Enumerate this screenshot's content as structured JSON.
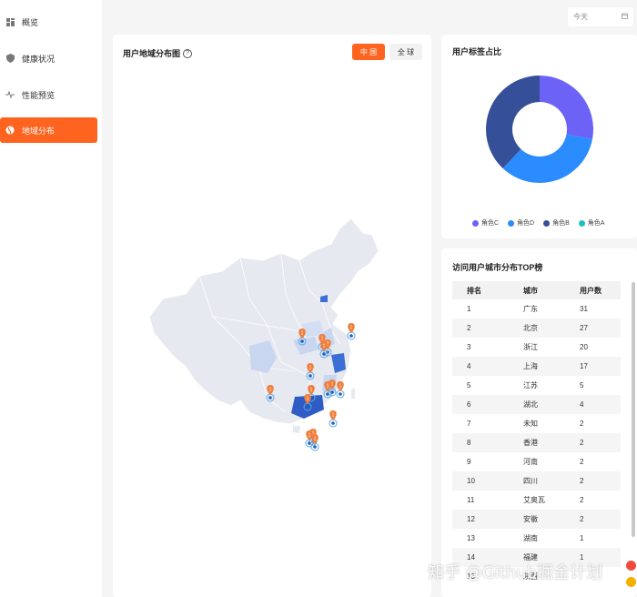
{
  "sidebar": {
    "items": [
      {
        "label": "概览",
        "icon": "dashboard-icon"
      },
      {
        "label": "健康状况",
        "icon": "shield-icon"
      },
      {
        "label": "性能预览",
        "icon": "pulse-icon"
      },
      {
        "label": "地域分布",
        "icon": "globe-icon",
        "active": true
      }
    ]
  },
  "date_picker": {
    "value": "今天",
    "icon": "calendar-icon"
  },
  "map_panel": {
    "title": "用户地域分布图",
    "help_icon": "question-icon",
    "scope_buttons": [
      "中 国",
      "全 球"
    ],
    "active_scope": "中 国",
    "marker_labels": [
      "1",
      "1",
      "1",
      "2",
      "1",
      "1",
      "1",
      "1",
      "1",
      "1",
      "1",
      "1",
      "1",
      "1",
      "1",
      "1"
    ]
  },
  "donut_panel": {
    "title": "用户标签占比",
    "chart_data": {
      "type": "pie",
      "slices": [
        {
          "name": "角色C",
          "value": 28,
          "color": "#6c63f6"
        },
        {
          "name": "角色D",
          "value": 34,
          "color": "#2b8cff"
        },
        {
          "name": "角色B",
          "value": 38,
          "color": "#354f98"
        },
        {
          "name": "角色A",
          "value": 0,
          "color": "#1fbfbf"
        }
      ]
    },
    "legend": [
      "角色C",
      "角色D",
      "角色B",
      "角色A"
    ]
  },
  "rank_panel": {
    "title": "访问用户城市分布TOP榜",
    "columns": [
      "排名",
      "城市",
      "用户数"
    ],
    "rows": [
      [
        "1",
        "广东",
        "31"
      ],
      [
        "2",
        "北京",
        "27"
      ],
      [
        "3",
        "浙江",
        "20"
      ],
      [
        "4",
        "上海",
        "17"
      ],
      [
        "5",
        "江苏",
        "5"
      ],
      [
        "6",
        "湖北",
        "4"
      ],
      [
        "7",
        "未知",
        "2"
      ],
      [
        "8",
        "香港",
        "2"
      ],
      [
        "9",
        "河南",
        "2"
      ],
      [
        "10",
        "四川",
        "2"
      ],
      [
        "11",
        "艾奥瓦",
        "2"
      ],
      [
        "12",
        "安徽",
        "2"
      ],
      [
        "13",
        "湖南",
        "1"
      ],
      [
        "14",
        "福建",
        "1"
      ],
      [
        "15",
        "陕西",
        ""
      ]
    ]
  },
  "watermark": "知乎 @Github掘金计划"
}
